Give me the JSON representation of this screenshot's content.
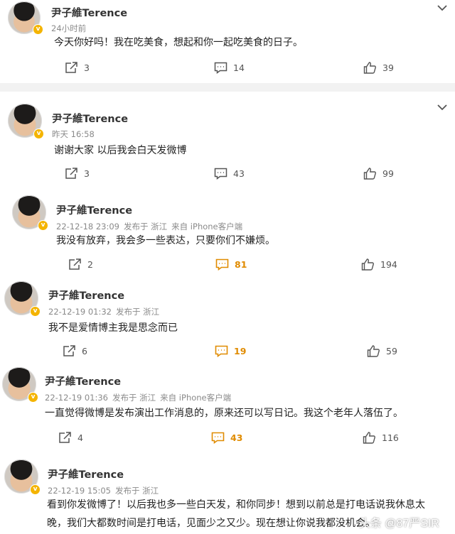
{
  "posts": [
    {
      "user": "尹子維Terence",
      "time": "24小时前",
      "text": "今天你好吗！我在吃美食，想起和你一起吃美食的日子。",
      "reposts": "3",
      "comments": "14",
      "likes": "39"
    },
    {
      "user": "尹子維Terence",
      "time": "昨天 16:58",
      "text": "谢谢大家 以后我会白天发微博",
      "reposts": "3",
      "comments": "43",
      "likes": "99"
    },
    {
      "user": "尹子維Terence",
      "time": "22-12-18 23:09",
      "location": "发布于 浙江",
      "source": "来自 iPhone客户端",
      "text": "我没有放弃，我会多一些表达，只要你们不嫌烦。",
      "reposts": "2",
      "comments": "81",
      "likes": "194"
    },
    {
      "user": "尹子維Terence",
      "time": "22-12-19 01:32",
      "location": "发布于 浙江",
      "text": "我不是爱情博主我是思念而已",
      "reposts": "6",
      "comments": "19",
      "likes": "59"
    },
    {
      "user": "尹子維Terence",
      "time": "22-12-19 01:36",
      "location": "发布于 浙江",
      "source": "来自 iPhone客户端",
      "text": "一直觉得微博是发布演出工作消息的，原来还可以写日记。我这个老年人落伍了。",
      "reposts": "4",
      "comments": "43",
      "likes": "116"
    },
    {
      "user": "尹子維Terence",
      "time": "22-12-19 15:05",
      "location": "发布于 浙江",
      "text_line1": "看到你发微博了！以后我也多一些白天发，和你同步！想到以前总是打电话说我休息太",
      "text_line2": "晚，我们大都数时间是打电话，见面少之又少。现在想让你说我都没机会。"
    }
  ],
  "watermark": "头条 @87严SIR",
  "icons": {
    "verified": "verified-badge-icon",
    "repost": "share-icon",
    "comment": "comment-icon",
    "like": "thumbs-up-icon",
    "more": "chevron-down-icon"
  },
  "colors": {
    "hot": "#e08b00",
    "verified": "#f4b400",
    "meta": "#8a8a8a"
  }
}
